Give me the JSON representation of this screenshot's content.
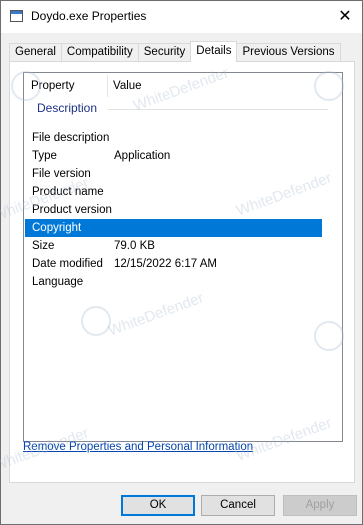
{
  "window": {
    "title": "Doydo.exe Properties",
    "close_glyph": "✕"
  },
  "tabs": [
    {
      "label": "General",
      "active": false
    },
    {
      "label": "Compatibility",
      "active": false
    },
    {
      "label": "Security",
      "active": false
    },
    {
      "label": "Details",
      "active": true
    },
    {
      "label": "Previous Versions",
      "active": false
    }
  ],
  "details": {
    "columns": {
      "property": "Property",
      "value": "Value"
    },
    "group": "Description",
    "rows": [
      {
        "property": "File description",
        "value": ""
      },
      {
        "property": "Type",
        "value": "Application"
      },
      {
        "property": "File version",
        "value": ""
      },
      {
        "property": "Product name",
        "value": ""
      },
      {
        "property": "Product version",
        "value": ""
      },
      {
        "property": "Copyright",
        "value": "",
        "selected": true
      },
      {
        "property": "Size",
        "value": "79.0 KB"
      },
      {
        "property": "Date modified",
        "value": "12/15/2022 6:17 AM"
      },
      {
        "property": "Language",
        "value": ""
      }
    ]
  },
  "link": {
    "label": "Remove Properties and Personal Information"
  },
  "buttons": {
    "ok": "OK",
    "cancel": "Cancel",
    "apply": "Apply"
  },
  "watermark": {
    "text": "WhiteDefender"
  },
  "colors": {
    "selection": "#0078d7",
    "group_header": "#1e3287",
    "link": "#0645ad"
  }
}
